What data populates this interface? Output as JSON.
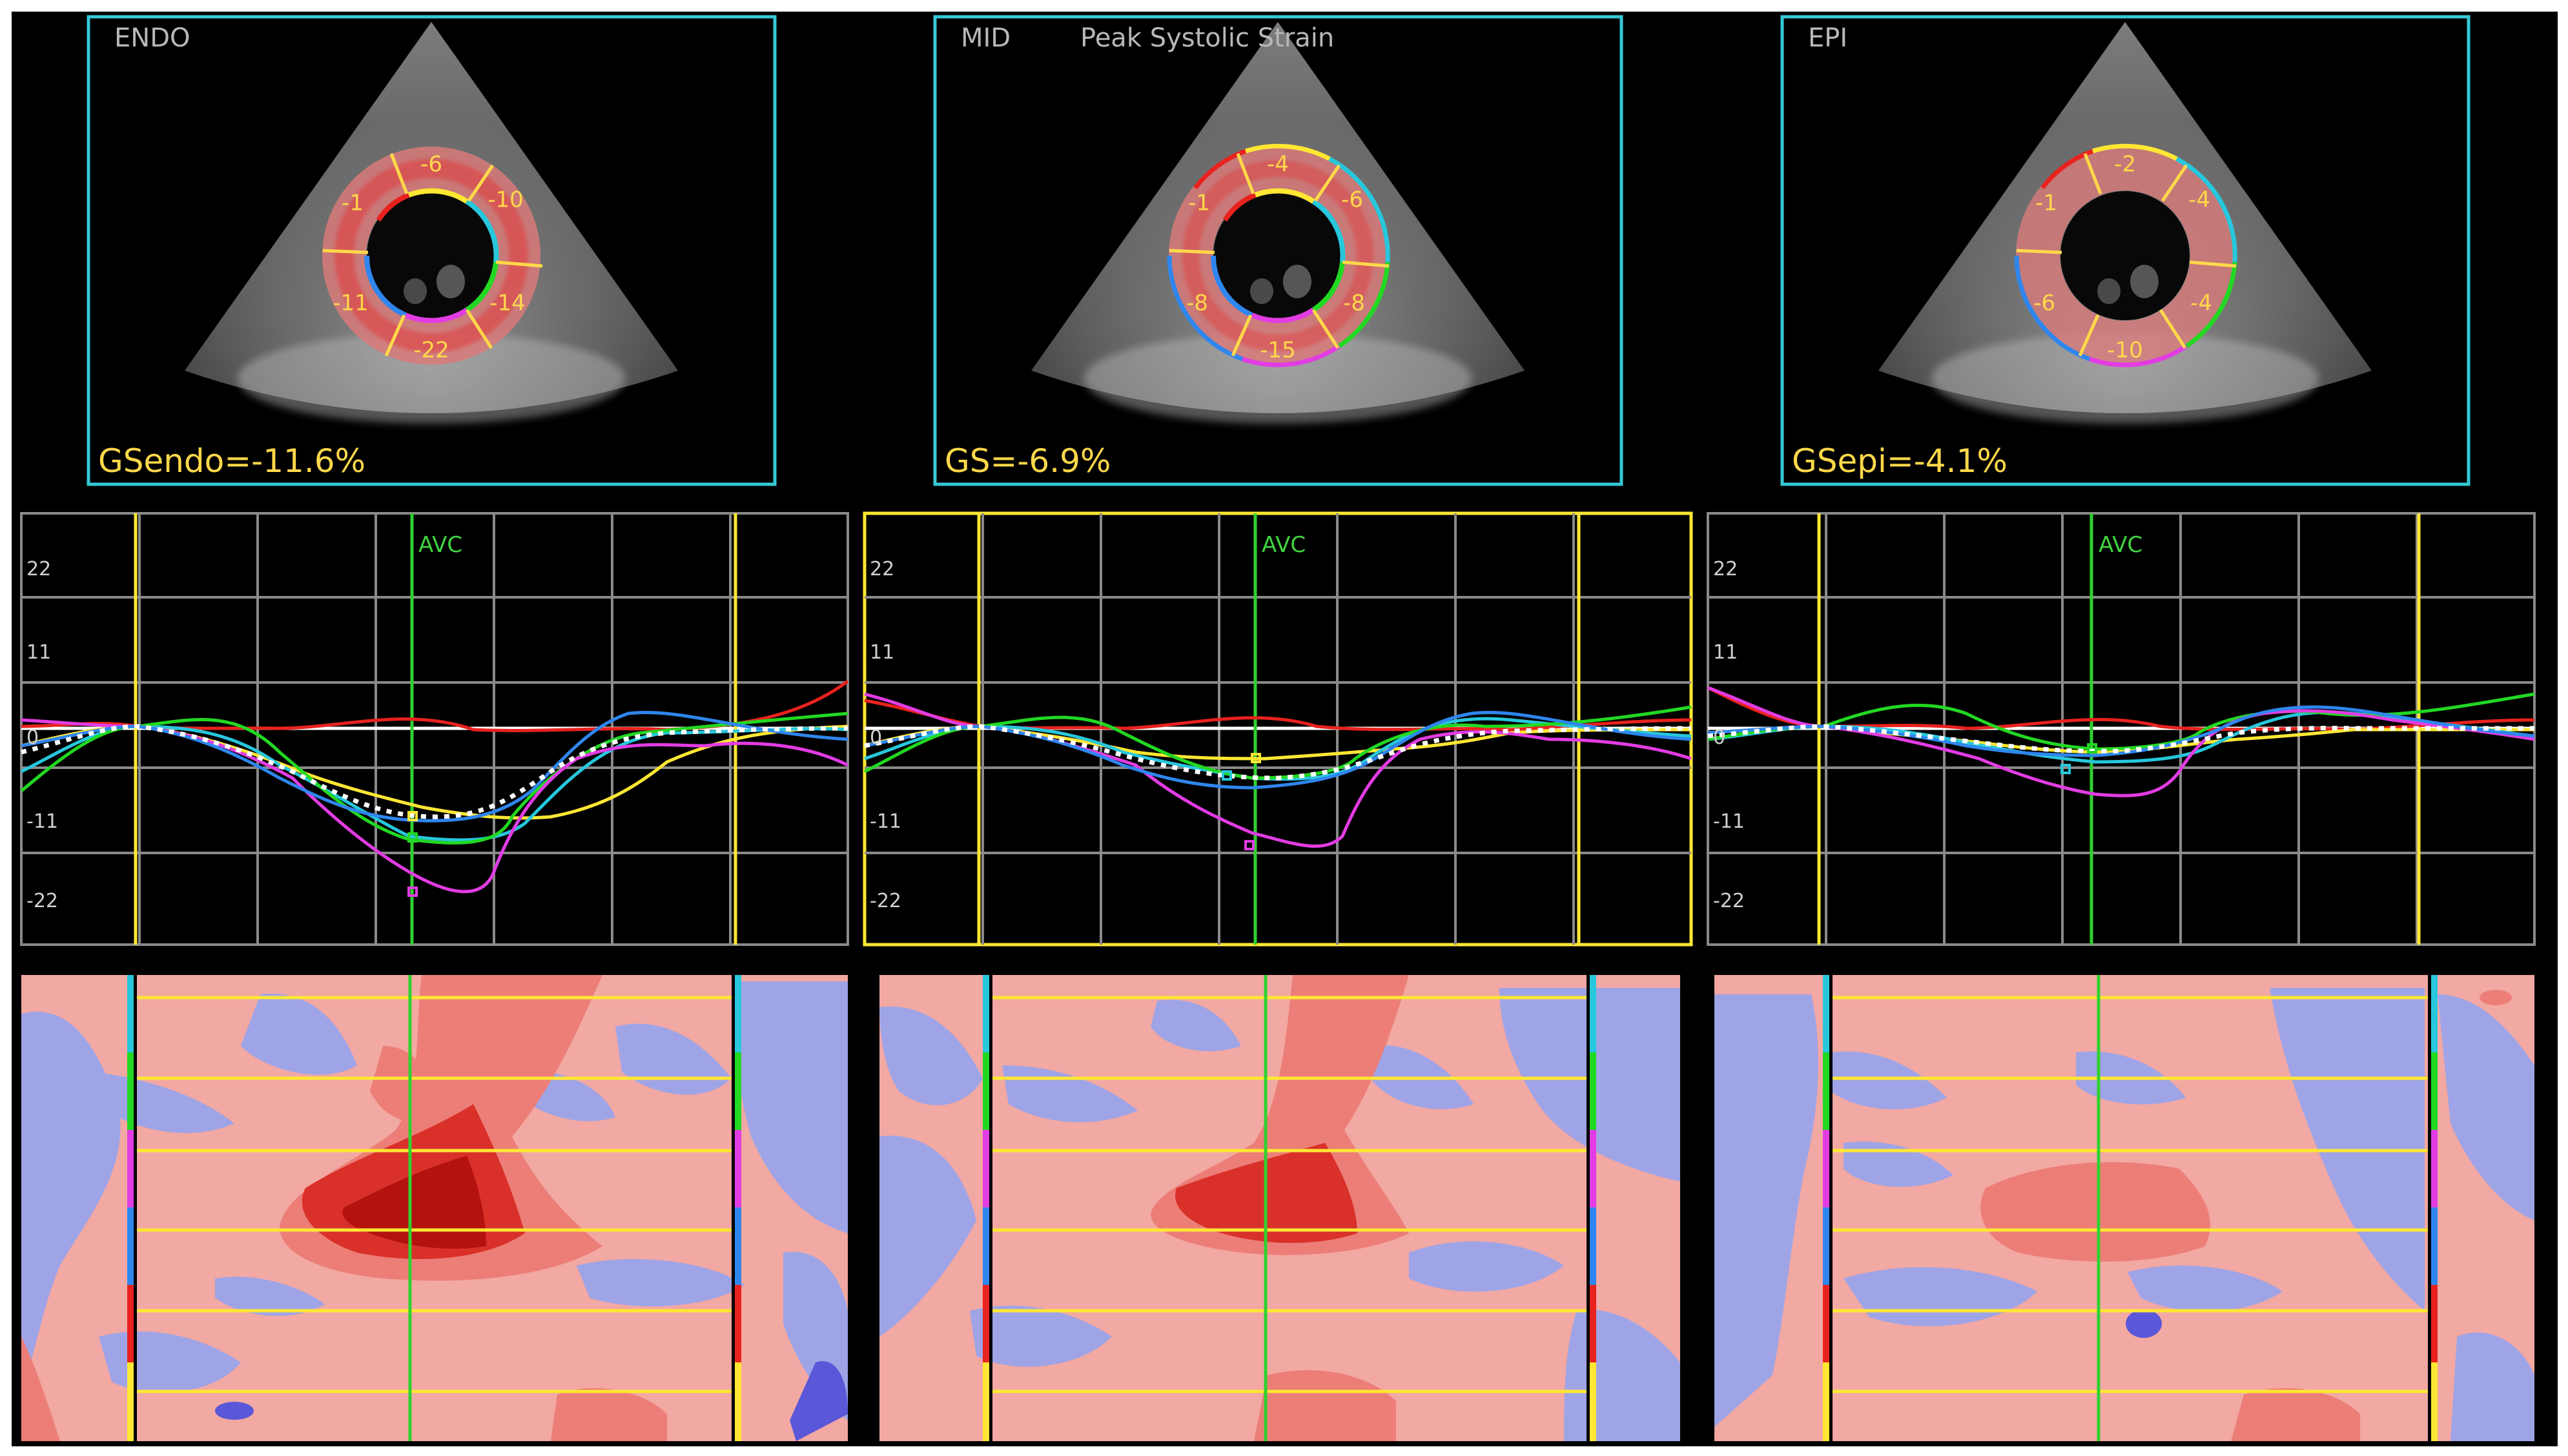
{
  "panels": [
    {
      "id": "endo",
      "view_label": "ENDO",
      "subtitle": "",
      "gs_text": "GSendo=-11.6%",
      "segment_values": [
        "-6",
        "-10",
        "-14",
        "-22",
        "-11",
        "-1"
      ],
      "avc_label": "AVC",
      "y_ticks": [
        "22",
        "11",
        "0",
        "-11",
        "-22"
      ]
    },
    {
      "id": "mid",
      "view_label": "MID",
      "subtitle": "Peak Systolic Strain",
      "gs_text": "GS=-6.9%",
      "segment_values": [
        "-4",
        "-6",
        "-8",
        "-15",
        "-8",
        "-1"
      ],
      "avc_label": "AVC",
      "y_ticks": [
        "22",
        "11",
        "0",
        "-11",
        "-22"
      ]
    },
    {
      "id": "epi",
      "view_label": "EPI",
      "subtitle": "",
      "gs_text": "GSepi=-4.1%",
      "segment_values": [
        "-2",
        "-4",
        "-4",
        "-10",
        "-6",
        "-1"
      ],
      "avc_label": "AVC",
      "y_ticks": [
        "22",
        "11",
        "0",
        "-11",
        "-22"
      ]
    }
  ],
  "colors": {
    "background": "#000000",
    "frame_cyan": "#35c9d6",
    "label_yellow": "#ffd84a",
    "avc_green": "#2fd12f",
    "segment_colors": [
      "#ffe733",
      "#27c7dc",
      "#22d822",
      "#e23ce3",
      "#2f86ee",
      "#e8221e"
    ]
  }
}
